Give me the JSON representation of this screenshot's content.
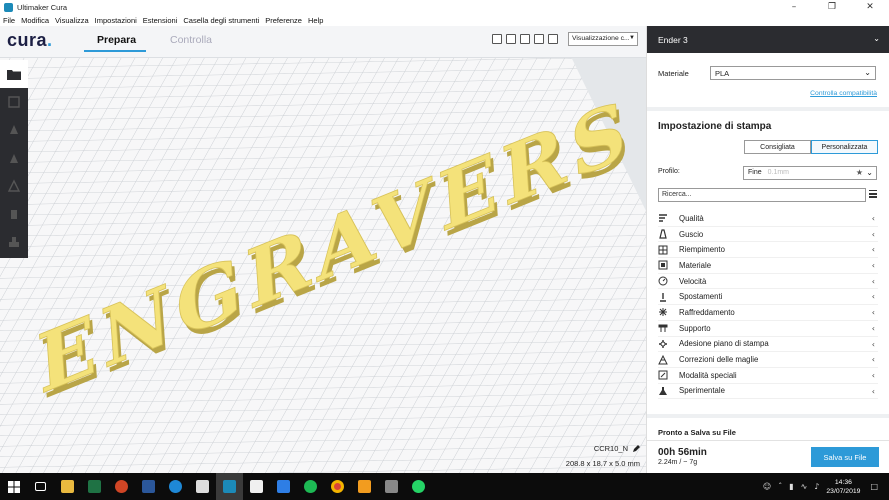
{
  "window": {
    "title": "Ultimaker Cura"
  },
  "menu": [
    "File",
    "Modifica",
    "Visualizza",
    "Impostazioni",
    "Estensioni",
    "Casella degli strumenti",
    "Preferenze",
    "Help"
  ],
  "header": {
    "logo_text": "cura",
    "logo_dot": ".",
    "tabs": [
      {
        "label": "Prepara",
        "active": true
      },
      {
        "label": "Controlla",
        "active": false
      }
    ],
    "view_mode": "Visualizzazione c..."
  },
  "scene": {
    "model_text": "ENGRAVERS",
    "model_color": "#f4e27a",
    "object_name": "CCR10_N",
    "object_dimensions": "208.8 x 18.7 x 5.0 mm"
  },
  "panel": {
    "printer": "Ender 3",
    "material_label": "Materiale",
    "material_value": "PLA",
    "compat_link": "Controlla compatibilità",
    "settings_title": "Impostazione di stampa",
    "mode_buttons": [
      {
        "label": "Consigliata",
        "active": false
      },
      {
        "label": "Personalizzata",
        "active": true
      }
    ],
    "profile_label": "Profilo:",
    "profile_value": "Fine",
    "profile_sub": "0.1mm",
    "search_placeholder": "Ricerca...",
    "categories": [
      {
        "label": "Qualità",
        "icon": "quality-icon"
      },
      {
        "label": "Guscio",
        "icon": "shell-icon"
      },
      {
        "label": "Riempimento",
        "icon": "infill-icon"
      },
      {
        "label": "Materiale",
        "icon": "material-icon"
      },
      {
        "label": "Velocità",
        "icon": "speed-icon"
      },
      {
        "label": "Spostamenti",
        "icon": "travel-icon"
      },
      {
        "label": "Raffreddamento",
        "icon": "cooling-icon"
      },
      {
        "label": "Supporto",
        "icon": "support-icon"
      },
      {
        "label": "Adesione piano di stampa",
        "icon": "adhesion-icon"
      },
      {
        "label": "Correzioni delle maglie",
        "icon": "mesh-fix-icon"
      },
      {
        "label": "Modalità speciali",
        "icon": "special-modes-icon"
      },
      {
        "label": "Sperimentale",
        "icon": "experimental-icon"
      }
    ],
    "status": "Pronto a Salva su File",
    "print_time": "00h 56min",
    "print_material": "2.24m / ~ 7g",
    "save_button": "Salva su File"
  },
  "taskbar": {
    "clock_time": "14:36",
    "clock_date": "23/07/2019"
  },
  "colors": {
    "accent": "#2d9ad8",
    "dark": "#2b2c30",
    "grid_line": "#c9cdd2"
  }
}
